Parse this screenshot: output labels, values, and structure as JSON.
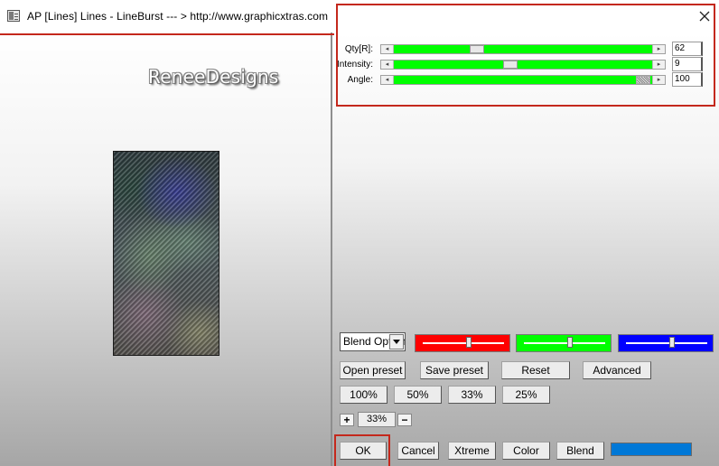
{
  "window": {
    "title": "AP [Lines]  Lines - LineBurst    --- > http://www.graphicxtras.com",
    "close_icon": "close-icon"
  },
  "preview": {
    "watermark": "ReneeDesigns"
  },
  "sliders": [
    {
      "label": "Qty[R]:",
      "value": "62"
    },
    {
      "label": "Intensity:",
      "value": "9"
    },
    {
      "label": "Angle:",
      "value": "100"
    }
  ],
  "blend_options": {
    "selected": "Blend Options"
  },
  "color_sliders": {
    "red": "#ff0000",
    "green": "#00ff00",
    "blue": "#0000ff"
  },
  "buttons": {
    "open_preset": "Open preset",
    "save_preset": "Save preset",
    "reset": "Reset",
    "advanced": "Advanced",
    "ok": "OK",
    "cancel": "Cancel",
    "xtreme": "Xtreme",
    "color": "Color",
    "blend": "Blend"
  },
  "zoom_presets": [
    "100%",
    "50%",
    "33%",
    "25%"
  ],
  "zoom": {
    "plus": "+",
    "value": "33%",
    "minus": "−"
  },
  "color_swatch": "#0078d7",
  "annotation_color": "#c4281c"
}
